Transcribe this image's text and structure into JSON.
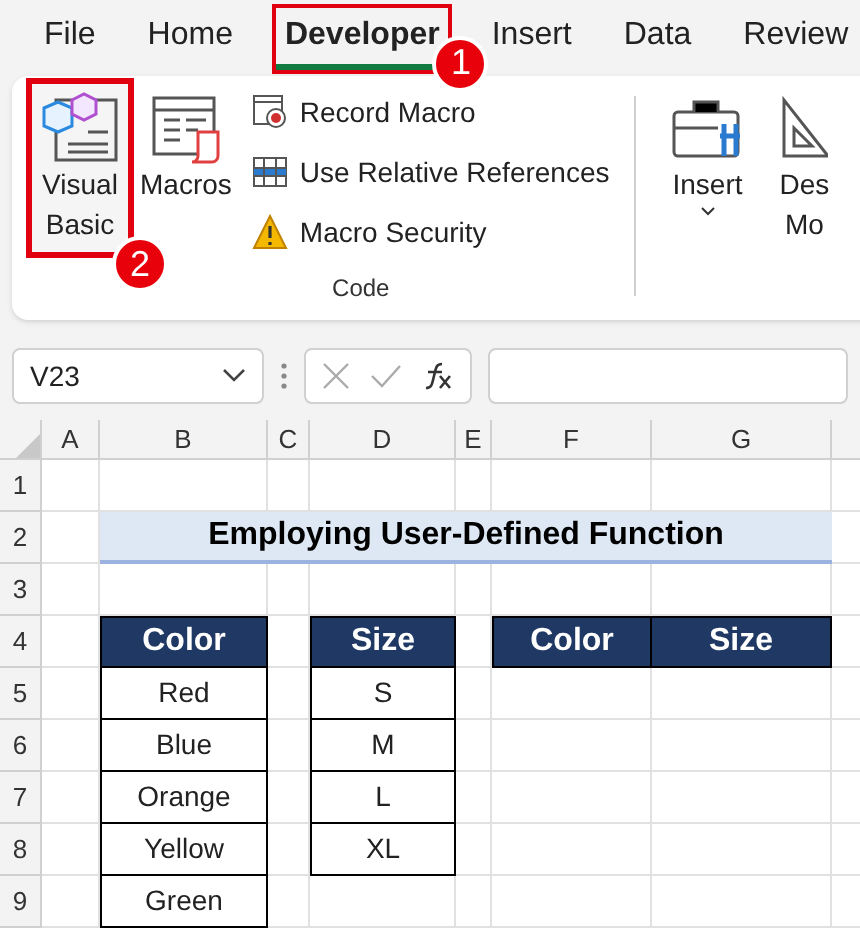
{
  "menu_tabs": [
    {
      "label": "File",
      "selected": false,
      "highlighted": false
    },
    {
      "label": "Home",
      "selected": false,
      "highlighted": false
    },
    {
      "label": "Developer",
      "selected": true,
      "highlighted": true,
      "callout": "1"
    },
    {
      "label": "Insert",
      "selected": false,
      "highlighted": false
    },
    {
      "label": "Data",
      "selected": false,
      "highlighted": false
    },
    {
      "label": "Review",
      "selected": false,
      "highlighted": false
    }
  ],
  "ribbon": {
    "code_group": {
      "large_buttons": [
        {
          "kind": "visual-basic",
          "lines": [
            "Visual",
            "Basic"
          ],
          "highlighted": true,
          "callout": "2"
        },
        {
          "kind": "macros",
          "lines": [
            "Macros"
          ],
          "highlighted": false
        }
      ],
      "small_buttons": [
        {
          "kind": "record",
          "label": "Record Macro"
        },
        {
          "kind": "relative",
          "label": "Use Relative References"
        },
        {
          "kind": "security",
          "label": "Macro Security"
        }
      ],
      "label": "Code"
    },
    "controls_group": {
      "large_buttons": [
        {
          "kind": "insert",
          "lines": [
            "Insert"
          ],
          "dropdown": true
        },
        {
          "kind": "design",
          "lines": [
            "Des",
            "Mo"
          ],
          "dropdown": false
        }
      ]
    }
  },
  "formula_bar": {
    "name_box": "V23"
  },
  "sheet": {
    "columns": [
      "A",
      "B",
      "C",
      "D",
      "E",
      "F",
      "G"
    ],
    "rows": [
      "1",
      "2",
      "3",
      "4",
      "5",
      "6",
      "7",
      "8",
      "9"
    ],
    "title": "Employing User-Defined Function",
    "color_table": {
      "header": "Color",
      "values": [
        "Red",
        "Blue",
        "Orange",
        "Yellow",
        "Green"
      ]
    },
    "size_table": {
      "header": "Size",
      "values": [
        "S",
        "M",
        "L",
        "XL"
      ]
    },
    "output_table": {
      "headers": [
        "Color",
        "Size"
      ]
    }
  }
}
